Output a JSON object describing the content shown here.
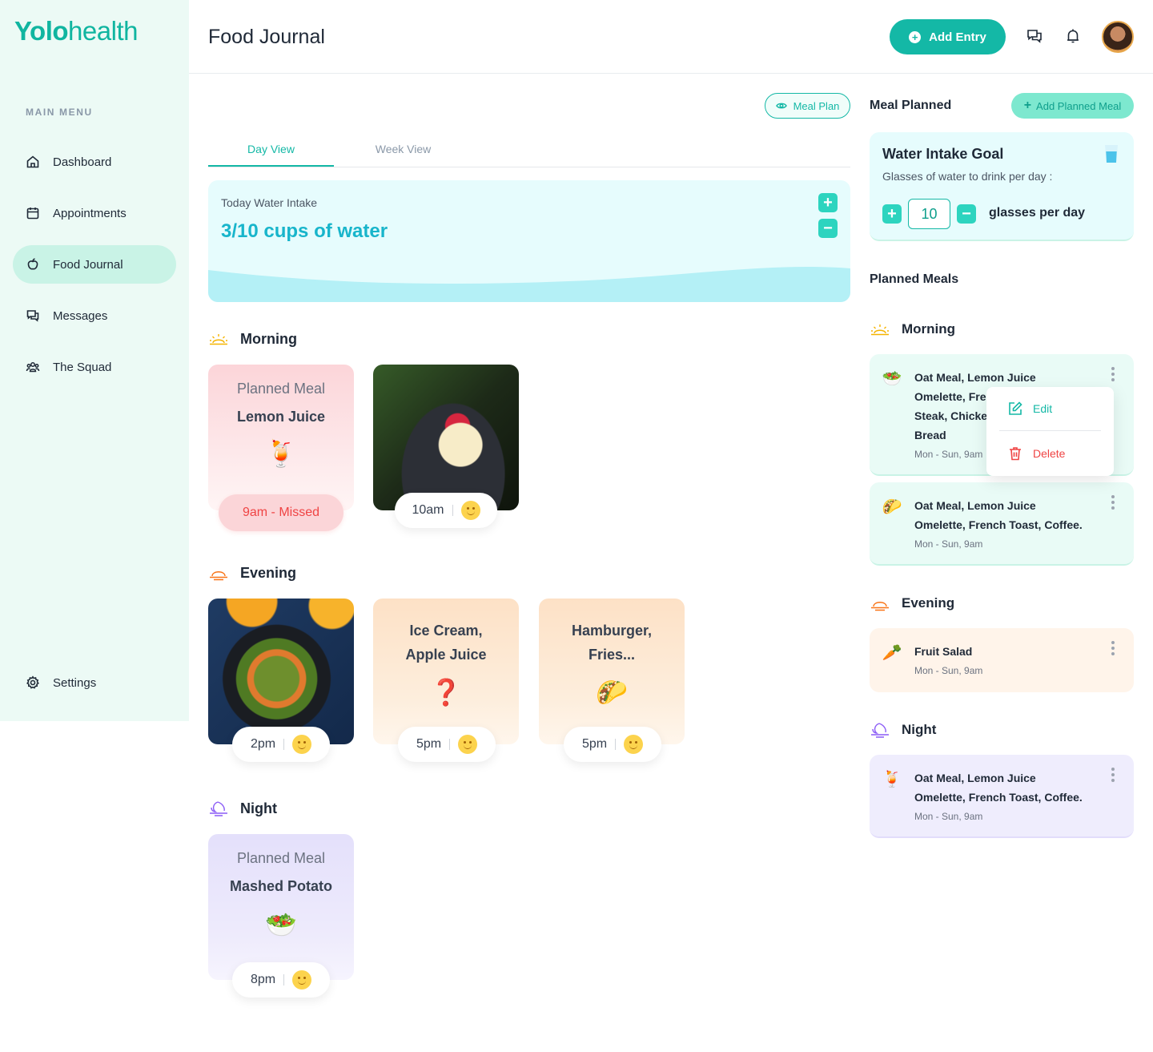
{
  "app": {
    "brand_main": "Yolo",
    "brand_light": "health"
  },
  "sidebar": {
    "menu_title": "MAIN MENU",
    "items": [
      {
        "label": "Dashboard",
        "icon": "home-icon"
      },
      {
        "label": "Appointments",
        "icon": "calendar-icon"
      },
      {
        "label": "Food Journal",
        "icon": "apple-icon",
        "active": true
      },
      {
        "label": "Messages",
        "icon": "chat-icon"
      },
      {
        "label": "The Squad",
        "icon": "group-icon"
      }
    ],
    "settings_label": "Settings"
  },
  "header": {
    "title": "Food Journal",
    "add_entry_label": "Add Entry"
  },
  "main": {
    "meal_plan_label": "Meal Plan",
    "tabs": [
      {
        "label": "Day View",
        "active": true
      },
      {
        "label": "Week View"
      }
    ],
    "water": {
      "label": "Today Water Intake",
      "value": "3/10 cups of water",
      "plus": "+",
      "minus": "−"
    },
    "sections": {
      "morning": "Morning",
      "evening": "Evening",
      "night": "Night"
    },
    "cards": {
      "morning_planned": {
        "line1": "Planned Meal",
        "line2": "Lemon Juice",
        "emoji": "🍹",
        "status": "9am - Missed"
      },
      "morning_photo": {
        "time": "10am"
      },
      "evening_photo": {
        "time": "2pm"
      },
      "evening_icecream": {
        "line1": "Ice Cream,",
        "line2": "Apple Juice",
        "emoji": "❓",
        "time": "5pm"
      },
      "evening_burger": {
        "line1": "Hamburger,",
        "line2": "Fries...",
        "emoji": "🌮",
        "time": "5pm"
      },
      "night_planned": {
        "line1": "Planned Meal",
        "line2": "Mashed Potato",
        "emoji": "🥗",
        "time": "8pm"
      }
    }
  },
  "right": {
    "meal_planned_title": "Meal Planned",
    "add_planned_label": "Add Planned Meal",
    "goal": {
      "title": "Water Intake Goal",
      "subtitle": "Glasses of water to drink per day :",
      "value": "10",
      "unit": "glasses per day",
      "plus": "+",
      "minus": "−"
    },
    "planned_meals_title": "Planned Meals",
    "sections": {
      "morning": "Morning",
      "evening": "Evening",
      "night": "Night"
    },
    "cards": [
      {
        "lines": [
          "Oat Meal, Lemon Juice",
          "Omelette, Fre",
          "Steak, Chicke",
          "Bread"
        ],
        "time": "Mon - Sun, 9am",
        "emoji": "🥗"
      },
      {
        "lines": [
          "Oat Meal, Lemon Juice",
          "Omelette, French Toast, Coffee."
        ],
        "time": "Mon - Sun, 9am",
        "emoji": "🌮"
      },
      {
        "lines": [
          "Fruit Salad"
        ],
        "time": "Mon - Sun, 9am",
        "emoji": "🥕"
      },
      {
        "lines": [
          "Oat Meal, Lemon Juice",
          "Omelette, French Toast, Coffee."
        ],
        "time": "Mon - Sun, 9am",
        "emoji": "🍹"
      }
    ],
    "context_menu": {
      "edit": "Edit",
      "delete": "Delete"
    }
  },
  "colors": {
    "accent": "#14b8a6",
    "water": "#18b5cb",
    "missed": "#ef4444"
  }
}
